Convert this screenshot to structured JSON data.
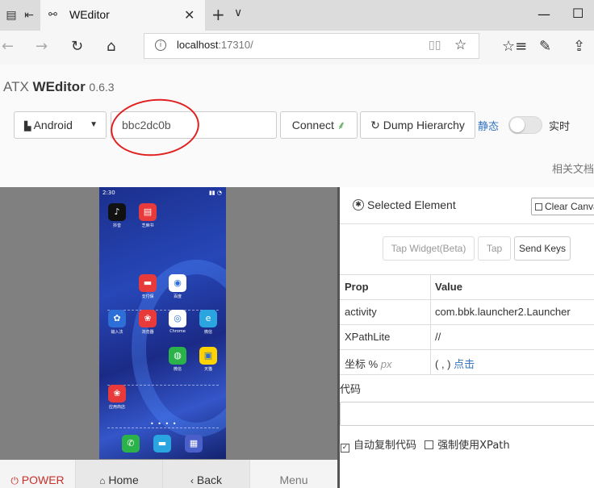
{
  "browser": {
    "tab_title": "WEditor",
    "url_host": "localhost",
    "url_rest": ":17310/"
  },
  "app": {
    "brand_prefix": "ATX ",
    "brand_name": "WEditor",
    "version": "0.6.3",
    "platform_select": "Android",
    "device_serial": "bbc2dc0b",
    "connect_label": "Connect",
    "dump_label": "Dump Hierarchy",
    "mode_static": "静态",
    "mode_live": "实时",
    "docs_link": "相关文档",
    "live_mode_enabled": false
  },
  "phone": {
    "time": "2:30",
    "apps": [
      {
        "label": "抖音",
        "color": "#111111",
        "glyph": "♪"
      },
      {
        "label": "芝麻书",
        "color": "#e83a3a",
        "glyph": "▤"
      },
      {
        "label": "支付保",
        "color": "#e83a3a",
        "glyph": "▬"
      },
      {
        "label": "百度",
        "color": "#ffffff",
        "glyph": "◉"
      },
      {
        "label": "输入法",
        "color": "#2d6fd6",
        "glyph": "✿"
      },
      {
        "label": "浏览器",
        "color": "#e83a3a",
        "glyph": "❀"
      },
      {
        "label": "Chrome",
        "color": "#ffffff",
        "glyph": "◎"
      },
      {
        "label": "微信",
        "color": "#2aa5e0",
        "glyph": "e"
      },
      {
        "label": "微信",
        "color": "#2bb34a",
        "glyph": "◍"
      },
      {
        "label": "天猫",
        "color": "#ffd200",
        "glyph": "▣"
      },
      {
        "label": "应用商店",
        "color": "#e83a3a",
        "glyph": "❀"
      }
    ]
  },
  "device_nav": {
    "power": "POWER",
    "home": "Home",
    "back": "Back",
    "menu": "Menu"
  },
  "panel": {
    "title": "Selected Element",
    "clear_label": "Clear Canvas",
    "tap_widget": "Tap Widget(Beta)",
    "tap": "Tap",
    "send_keys": "Send Keys",
    "col_prop": "Prop",
    "col_value": "Value",
    "rows": [
      {
        "k": "activity",
        "v": "com.bbk.launcher2.Launcher"
      },
      {
        "k": "XPathLite",
        "v": "//"
      }
    ],
    "coord_key": "坐标 %",
    "coord_unit": "px",
    "coord_value": "( , )",
    "coord_link": "点击",
    "code_label": "代码",
    "auto_copy": "自动复制代码",
    "force_xpath": "强制使用XPath"
  }
}
